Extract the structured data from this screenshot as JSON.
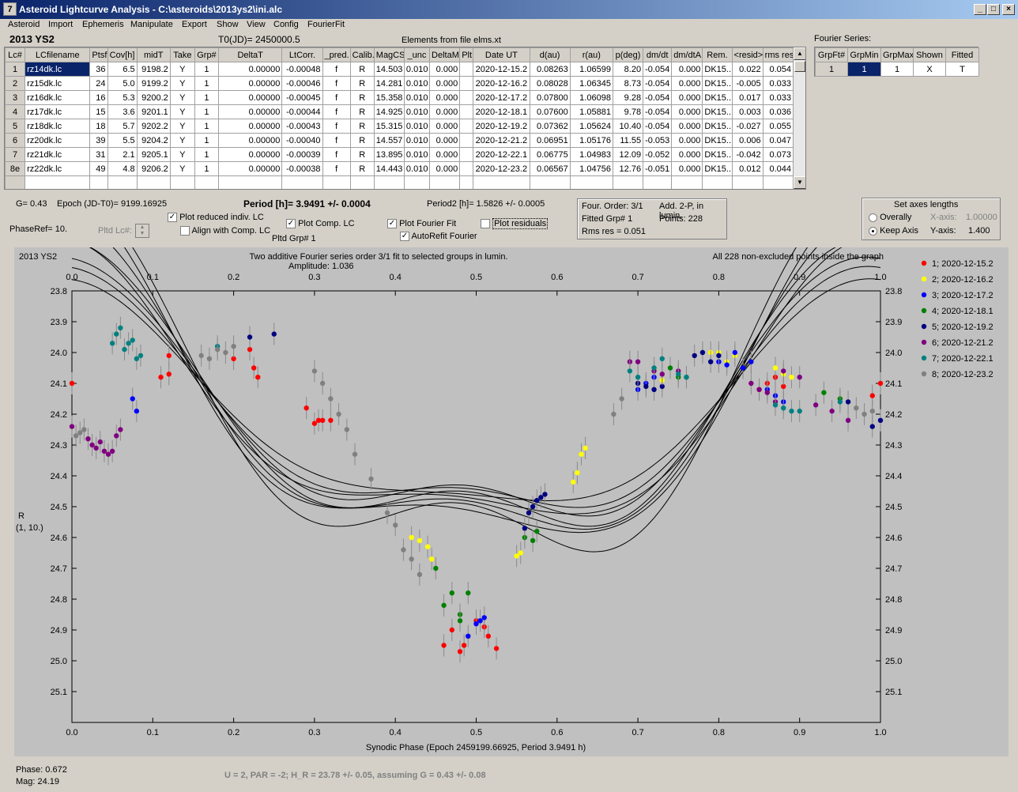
{
  "window": {
    "title": "Asteroid Lightcurve Analysis - C:\\asteroids\\2013ys2\\ini.alc",
    "icon": "7"
  },
  "menu": [
    "Asteroid",
    "Import",
    "Ephemeris",
    "Manipulate",
    "Export",
    "Show",
    "View",
    "Config",
    "FourierFit"
  ],
  "header": {
    "object": "2013 YS2",
    "t0": "T0(JD)= 2450000.5",
    "elements": "Elements from file elms.xt"
  },
  "table": {
    "columns": [
      "Lc#",
      "LCfilename",
      "Ptsf",
      "Cov[h]",
      "midT",
      "Take",
      "Grp#",
      "DeltaT",
      "LtCorr.",
      "_pred.",
      "Calib.",
      "MagCS",
      "_unc",
      "DeltaM",
      "Plt",
      "Date UT",
      "d(au)",
      "r(au)",
      "p(deg)",
      "dm/dt",
      "dm/dtA",
      "Rem.",
      "<resid>",
      "rms res"
    ],
    "rows": [
      [
        "1",
        "rz14dk.lc",
        "36",
        "6.5",
        "9198.2",
        "Y",
        "1",
        "0.00000",
        "-0.00048",
        "f",
        "R",
        "14.503",
        "0.010",
        "0.000",
        "",
        "2020-12-15.2",
        "0.08263",
        "1.06599",
        "8.20",
        "-0.054",
        "0.000",
        "DK15..",
        "0.022",
        "0.054"
      ],
      [
        "2",
        "rz15dk.lc",
        "24",
        "5.0",
        "9199.2",
        "Y",
        "1",
        "0.00000",
        "-0.00046",
        "f",
        "R",
        "14.281",
        "0.010",
        "0.000",
        "",
        "2020-12-16.2",
        "0.08028",
        "1.06345",
        "8.73",
        "-0.054",
        "0.000",
        "DK15..",
        "-0.005",
        "0.033"
      ],
      [
        "3",
        "rz16dk.lc",
        "16",
        "5.3",
        "9200.2",
        "Y",
        "1",
        "0.00000",
        "-0.00045",
        "f",
        "R",
        "15.358",
        "0.010",
        "0.000",
        "",
        "2020-12-17.2",
        "0.07800",
        "1.06098",
        "9.28",
        "-0.054",
        "0.000",
        "DK15..",
        "0.017",
        "0.033"
      ],
      [
        "4",
        "rz17dk.lc",
        "15",
        "3.6",
        "9201.1",
        "Y",
        "1",
        "0.00000",
        "-0.00044",
        "f",
        "R",
        "14.925",
        "0.010",
        "0.000",
        "",
        "2020-12-18.1",
        "0.07600",
        "1.05881",
        "9.78",
        "-0.054",
        "0.000",
        "DK15..",
        "0.003",
        "0.036"
      ],
      [
        "5",
        "rz18dk.lc",
        "18",
        "5.7",
        "9202.2",
        "Y",
        "1",
        "0.00000",
        "-0.00043",
        "f",
        "R",
        "15.315",
        "0.010",
        "0.000",
        "",
        "2020-12-19.2",
        "0.07362",
        "1.05624",
        "10.40",
        "-0.054",
        "0.000",
        "DK15..",
        "-0.027",
        "0.055"
      ],
      [
        "6",
        "rz20dk.lc",
        "39",
        "5.5",
        "9204.2",
        "Y",
        "1",
        "0.00000",
        "-0.00040",
        "f",
        "R",
        "14.557",
        "0.010",
        "0.000",
        "",
        "2020-12-21.2",
        "0.06951",
        "1.05176",
        "11.55",
        "-0.053",
        "0.000",
        "DK15..",
        "0.006",
        "0.047"
      ],
      [
        "7",
        "rz21dk.lc",
        "31",
        "2.1",
        "9205.1",
        "Y",
        "1",
        "0.00000",
        "-0.00039",
        "f",
        "R",
        "13.895",
        "0.010",
        "0.000",
        "",
        "2020-12-22.1",
        "0.06775",
        "1.04983",
        "12.09",
        "-0.052",
        "0.000",
        "DK15..",
        "-0.042",
        "0.073"
      ],
      [
        "8e",
        "rz22dk.lc",
        "49",
        "4.8",
        "9206.2",
        "Y",
        "1",
        "0.00000",
        "-0.00038",
        "f",
        "R",
        "14.443",
        "0.010",
        "0.000",
        "",
        "2020-12-23.2",
        "0.06567",
        "1.04756",
        "12.76",
        "-0.051",
        "0.000",
        "DK15..",
        "0.012",
        "0.044"
      ]
    ]
  },
  "fourier_series": {
    "label": "Fourier Series:",
    "columns": [
      "GrpFt#",
      "GrpMin",
      "GrpMax",
      "Shown",
      "Fitted"
    ],
    "row": [
      "1",
      "1",
      "1",
      "X",
      "T"
    ]
  },
  "params": {
    "g": "G= 0.43",
    "epoch": "Epoch (JD-T0)= 9199.16925",
    "period": "Period [h]= 3.9491 +/- 0.0004",
    "period2": "Period2 [h]= 1.5826 +/- 0.0005",
    "phaseref": "PhaseRef= 10.",
    "pltd_lc": "Pltd Lc#:",
    "plot_reduced": "Plot reduced indiv. LC",
    "align": "Align with Comp. LC",
    "plot_comp": "Plot Comp. LC",
    "pltd_grp": "Pltd Grp#  1",
    "plot_fourier": "Plot Fourier Fit",
    "autorefit": "AutoRefit Fourier",
    "plot_resid": "Plot residuals",
    "four_order": "Four. Order:  3/1",
    "add2p": "Add. 2-P, in lumin.",
    "fitted_grp": "Fitted Grp# 1",
    "points": "Points: 228",
    "rms": "Rms res     = 0.051",
    "axes_title": "Set axes lengths",
    "overally": "Overally",
    "keep_axis": "Keep Axis",
    "xaxis": "X-axis:",
    "xaxis_val": "1.00000",
    "yaxis": "Y-axis:",
    "yaxis_val": "1.400"
  },
  "chart_data": {
    "type": "scatter",
    "title_left": "2013 YS2",
    "title": "Two additive Fourier series order 3/1 fit to selected groups in lumin.",
    "subtitle": "Amplitude: 1.036",
    "title_right": "All 228 non-excluded points inside the graph",
    "xlabel": "Synodic Phase (Epoch 2459199.66925, Period 3.9491 h)",
    "ylabel": "R",
    "ylabel2": "(1, 10.)",
    "xlim": [
      0,
      1
    ],
    "ylim": [
      25.2,
      23.8
    ],
    "xticks": [
      "0.0",
      "0.1",
      "0.2",
      "0.3",
      "0.4",
      "0.5",
      "0.6",
      "0.7",
      "0.8",
      "0.9",
      "1.0"
    ],
    "yticks": [
      "23.8",
      "23.9",
      "24.0",
      "24.1",
      "24.2",
      "24.3",
      "24.4",
      "24.5",
      "24.6",
      "24.7",
      "24.8",
      "24.9",
      "25.0",
      "25.1"
    ],
    "series": [
      {
        "name": "1; 2020-12-15.2",
        "color": "#ff0000",
        "points": [
          [
            0.0,
            24.1
          ],
          [
            0.11,
            24.08
          ],
          [
            0.12,
            24.07
          ],
          [
            0.12,
            24.01
          ],
          [
            0.2,
            24.02
          ],
          [
            0.22,
            23.99
          ],
          [
            0.225,
            24.05
          ],
          [
            0.23,
            24.08
          ],
          [
            0.29,
            24.18
          ],
          [
            0.3,
            24.23
          ],
          [
            0.305,
            24.22
          ],
          [
            0.31,
            24.22
          ],
          [
            0.32,
            24.22
          ],
          [
            0.46,
            24.95
          ],
          [
            0.47,
            24.9
          ],
          [
            0.48,
            24.97
          ],
          [
            0.485,
            24.95
          ],
          [
            0.5,
            24.87
          ],
          [
            0.51,
            24.89
          ],
          [
            0.515,
            24.92
          ],
          [
            0.525,
            24.96
          ],
          [
            0.85,
            24.12
          ],
          [
            0.86,
            24.1
          ],
          [
            0.87,
            24.08
          ],
          [
            0.88,
            24.11
          ],
          [
            0.99,
            24.14
          ],
          [
            1.0,
            24.1
          ]
        ]
      },
      {
        "name": "2; 2020-12-16.2",
        "color": "#ffff00",
        "points": [
          [
            0.42,
            24.6
          ],
          [
            0.43,
            24.61
          ],
          [
            0.44,
            24.63
          ],
          [
            0.445,
            24.67
          ],
          [
            0.55,
            24.66
          ],
          [
            0.555,
            24.65
          ],
          [
            0.62,
            24.42
          ],
          [
            0.625,
            24.39
          ],
          [
            0.63,
            24.33
          ],
          [
            0.635,
            24.31
          ],
          [
            0.72,
            24.06
          ],
          [
            0.73,
            24.09
          ],
          [
            0.79,
            24.0
          ],
          [
            0.8,
            24.0
          ],
          [
            0.81,
            24.03
          ],
          [
            0.82,
            24.01
          ],
          [
            0.84,
            24.03
          ],
          [
            0.87,
            24.05
          ],
          [
            0.88,
            24.07
          ],
          [
            0.89,
            24.08
          ]
        ]
      },
      {
        "name": "3; 2020-12-17.2",
        "color": "#0000ff",
        "points": [
          [
            0.075,
            24.15
          ],
          [
            0.08,
            24.19
          ],
          [
            0.49,
            24.92
          ],
          [
            0.5,
            24.88
          ],
          [
            0.505,
            24.87
          ],
          [
            0.51,
            24.86
          ],
          [
            0.7,
            24.12
          ],
          [
            0.71,
            24.1
          ],
          [
            0.72,
            24.08
          ],
          [
            0.8,
            24.03
          ],
          [
            0.81,
            24.04
          ],
          [
            0.82,
            24.0
          ],
          [
            0.83,
            24.05
          ],
          [
            0.84,
            24.03
          ],
          [
            0.86,
            24.12
          ],
          [
            0.87,
            24.14
          ],
          [
            0.88,
            24.16
          ]
        ]
      },
      {
        "name": "4; 2020-12-18.1",
        "color": "#008000",
        "points": [
          [
            0.45,
            24.7
          ],
          [
            0.46,
            24.82
          ],
          [
            0.47,
            24.78
          ],
          [
            0.48,
            24.85
          ],
          [
            0.48,
            24.87
          ],
          [
            0.49,
            24.78
          ],
          [
            0.56,
            24.6
          ],
          [
            0.57,
            24.61
          ],
          [
            0.575,
            24.58
          ],
          [
            0.74,
            24.05
          ],
          [
            0.75,
            24.08
          ],
          [
            0.76,
            24.08
          ],
          [
            0.93,
            24.13
          ],
          [
            0.95,
            24.15
          ]
        ]
      },
      {
        "name": "5; 2020-12-19.2",
        "color": "#000080",
        "points": [
          [
            0.22,
            23.95
          ],
          [
            0.25,
            23.94
          ],
          [
            0.56,
            24.57
          ],
          [
            0.565,
            24.52
          ],
          [
            0.57,
            24.5
          ],
          [
            0.575,
            24.48
          ],
          [
            0.58,
            24.47
          ],
          [
            0.585,
            24.46
          ],
          [
            0.7,
            24.1
          ],
          [
            0.71,
            24.11
          ],
          [
            0.72,
            24.12
          ],
          [
            0.73,
            24.11
          ],
          [
            0.77,
            24.01
          ],
          [
            0.78,
            24.0
          ],
          [
            0.79,
            24.03
          ],
          [
            0.8,
            24.01
          ],
          [
            0.96,
            24.16
          ],
          [
            0.99,
            24.24
          ],
          [
            1.0,
            24.22
          ]
        ]
      },
      {
        "name": "6; 2020-12-21.2",
        "color": "#800080",
        "points": [
          [
            0.0,
            24.24
          ],
          [
            0.02,
            24.28
          ],
          [
            0.025,
            24.3
          ],
          [
            0.03,
            24.31
          ],
          [
            0.035,
            24.29
          ],
          [
            0.04,
            24.32
          ],
          [
            0.045,
            24.33
          ],
          [
            0.05,
            24.32
          ],
          [
            0.055,
            24.27
          ],
          [
            0.06,
            24.25
          ],
          [
            0.69,
            24.03
          ],
          [
            0.7,
            24.03
          ],
          [
            0.72,
            24.06
          ],
          [
            0.73,
            24.07
          ],
          [
            0.75,
            24.06
          ],
          [
            0.84,
            24.1
          ],
          [
            0.85,
            24.12
          ],
          [
            0.86,
            24.13
          ],
          [
            0.87,
            24.16
          ],
          [
            0.88,
            24.06
          ],
          [
            0.9,
            24.08
          ],
          [
            0.92,
            24.17
          ],
          [
            0.94,
            24.19
          ],
          [
            0.96,
            24.22
          ]
        ]
      },
      {
        "name": "7; 2020-12-22.1",
        "color": "#008080",
        "points": [
          [
            0.05,
            23.97
          ],
          [
            0.055,
            23.94
          ],
          [
            0.06,
            23.92
          ],
          [
            0.065,
            23.99
          ],
          [
            0.07,
            23.97
          ],
          [
            0.075,
            23.96
          ],
          [
            0.08,
            24.02
          ],
          [
            0.085,
            24.01
          ],
          [
            0.18,
            23.98
          ],
          [
            0.69,
            24.06
          ],
          [
            0.7,
            24.08
          ],
          [
            0.72,
            24.05
          ],
          [
            0.73,
            24.02
          ],
          [
            0.75,
            24.07
          ],
          [
            0.76,
            24.08
          ],
          [
            0.87,
            24.17
          ],
          [
            0.88,
            24.18
          ],
          [
            0.89,
            24.19
          ],
          [
            0.9,
            24.19
          ],
          [
            0.95,
            24.16
          ]
        ]
      },
      {
        "name": "8; 2020-12-23.2",
        "color": "#808080",
        "points": [
          [
            0.005,
            24.27
          ],
          [
            0.01,
            24.26
          ],
          [
            0.015,
            24.25
          ],
          [
            0.16,
            24.01
          ],
          [
            0.17,
            24.02
          ],
          [
            0.18,
            23.99
          ],
          [
            0.19,
            24.0
          ],
          [
            0.2,
            23.98
          ],
          [
            0.3,
            24.06
          ],
          [
            0.31,
            24.1
          ],
          [
            0.32,
            24.15
          ],
          [
            0.33,
            24.2
          ],
          [
            0.34,
            24.25
          ],
          [
            0.35,
            24.33
          ],
          [
            0.37,
            24.41
          ],
          [
            0.39,
            24.52
          ],
          [
            0.4,
            24.56
          ],
          [
            0.41,
            24.64
          ],
          [
            0.42,
            24.67
          ],
          [
            0.43,
            24.72
          ],
          [
            0.67,
            24.2
          ],
          [
            0.68,
            24.15
          ],
          [
            0.97,
            24.18
          ],
          [
            0.98,
            24.2
          ],
          [
            0.99,
            24.19
          ]
        ]
      }
    ]
  },
  "status": {
    "phase": "Phase:  0.672",
    "mag": "Mag:    24.19",
    "bottom": "U = 2, PAR = -2; H_R = 23.78 +/- 0.05, assuming G = 0.43 +/- 0.08"
  }
}
